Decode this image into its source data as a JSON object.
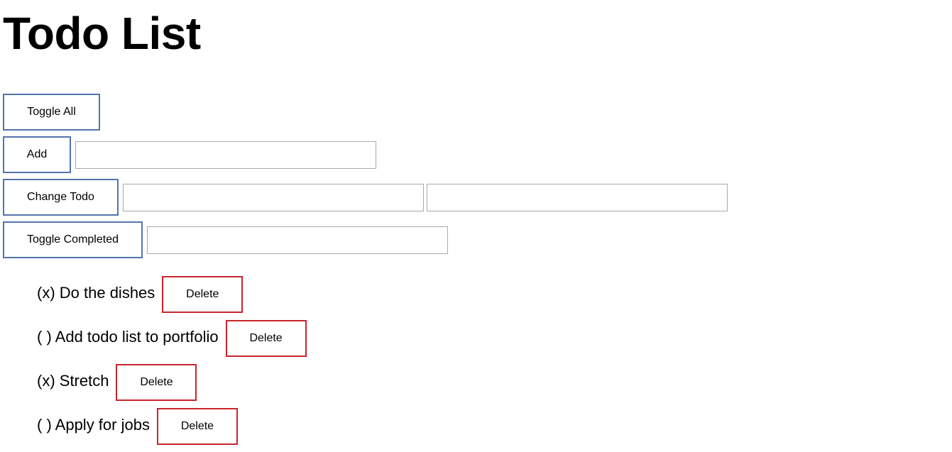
{
  "title": "Todo List",
  "controls": {
    "toggle_all_label": "Toggle All",
    "add_label": "Add",
    "add_input_value": "",
    "change_todo_label": "Change Todo",
    "change_position_value": "",
    "change_text_value": "",
    "toggle_completed_label": "Toggle Completed",
    "toggle_position_value": ""
  },
  "todos": [
    {
      "text": "(x) Do the dishes",
      "delete_label": "Delete"
    },
    {
      "text": "( ) Add todo list to portfolio",
      "delete_label": "Delete"
    },
    {
      "text": "(x) Stretch",
      "delete_label": "Delete"
    },
    {
      "text": "( ) Apply for jobs",
      "delete_label": "Delete"
    }
  ],
  "colors": {
    "primary_button_border": "#5274ad",
    "delete_button_border": "#c9252c",
    "input_border": "#a9a9a9"
  }
}
